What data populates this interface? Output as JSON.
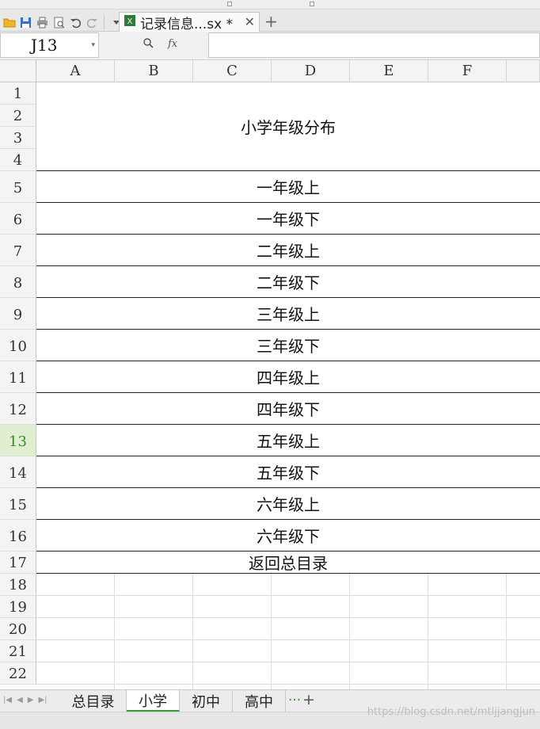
{
  "toolbar": {
    "doc_tab_title": "记录信息...sx *",
    "close_glyph": "✕",
    "new_tab_glyph": "+",
    "icons": [
      "open-folder-icon",
      "save-icon",
      "print-icon",
      "print-preview-icon",
      "undo-icon",
      "redo-icon",
      "quick-access-dropdown-icon",
      "excel-file-icon"
    ]
  },
  "formula_bar": {
    "name_box": "J13",
    "fx": "fx",
    "formula_value": ""
  },
  "grid": {
    "columns": [
      "A",
      "B",
      "C",
      "D",
      "E",
      "F"
    ],
    "rows": [
      "1",
      "2",
      "3",
      "4",
      "5",
      "6",
      "7",
      "8",
      "9",
      "10",
      "11",
      "12",
      "13",
      "14",
      "15",
      "16",
      "17",
      "18",
      "19",
      "20",
      "21",
      "22"
    ],
    "active_row": "13",
    "title_cell": "小学年级分布",
    "cells": [
      "一年级上",
      "一年级下",
      "二年级上",
      "二年级下",
      "三年级上",
      "三年级下",
      "四年级上",
      "四年级下",
      "五年级上",
      "五年级下",
      "六年级上",
      "六年级下"
    ],
    "back_link": "返回总目录"
  },
  "sheets": {
    "tabs": [
      "总目录",
      "小学",
      "初中",
      "高中"
    ],
    "active": "小学",
    "more": "···",
    "add": "+"
  },
  "watermark": "https://blog.csdn.net/mtljjangjun"
}
